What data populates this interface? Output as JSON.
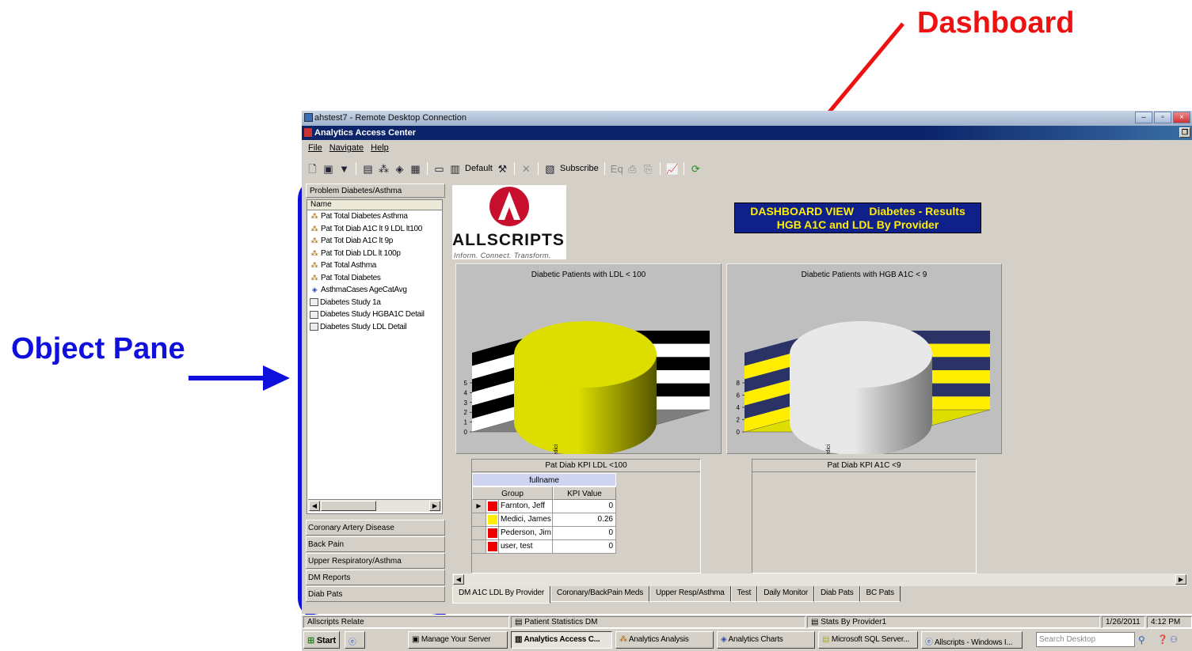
{
  "annotations": {
    "dashboard_label": "Dashboard",
    "object_pane_label": "Object Pane",
    "dashboard_color": "#ee1111",
    "object_pane_color": "#1010dd"
  },
  "rdp": {
    "title": "ahstest7 - Remote Desktop Connection",
    "minimize": "–",
    "restore": "▫",
    "close": "×"
  },
  "app": {
    "title": "Analytics Access Center"
  },
  "menu": [
    "File",
    "Navigate",
    "Help"
  ],
  "toolbar": {
    "default_label": "Default",
    "subscribe_label": "Subscribe"
  },
  "object_pane": {
    "header": "Problem Diabetes/Asthma",
    "column": "Name",
    "items": [
      {
        "icon": "kpi",
        "label": "Pat Total Diabetes Asthma"
      },
      {
        "icon": "kpi",
        "label": "Pat Tot Diab A1C lt 9 LDL lt100"
      },
      {
        "icon": "kpi",
        "label": "Pat Tot Diab A1C  lt 9p"
      },
      {
        "icon": "kpi",
        "label": "Pat Tot Diab LDL lt 100p"
      },
      {
        "icon": "kpi",
        "label": "Pat Total Asthma"
      },
      {
        "icon": "kpi",
        "label": "Pat Total Diabetes"
      },
      {
        "icon": "chart",
        "label": "AsthmaCases AgeCatAvg"
      },
      {
        "icon": "report",
        "label": "Diabetes Study 1a"
      },
      {
        "icon": "report",
        "label": "Diabetes Study HGBA1C Detail"
      },
      {
        "icon": "report",
        "label": "Diabetes Study LDL Detail"
      }
    ],
    "groups": [
      "Coronary Artery Disease",
      "Back Pain",
      "Upper Respiratory/Asthma",
      "DM Reports",
      "Diab Pats"
    ]
  },
  "dashboard": {
    "logo_text": "ALLSCRIPTS",
    "logo_tagline": "Inform. Connect. Transform.",
    "title_line1": "DASHBOARD VIEW     Diabetes - Results",
    "title_line2": "HGB A1C and LDL By Provider",
    "kpi_ldl_title": "Pat Diab KPI LDL <100",
    "kpi_a1c_title": "Pat Diab KPI A1C <9",
    "kpi_table": {
      "fullname_header": "fullname",
      "col_group": "Group",
      "col_value": "KPI Value",
      "rows": [
        {
          "indicator": "▶",
          "color": "#ee0000",
          "name": "Farnton, Jeff",
          "value": "0"
        },
        {
          "indicator": "",
          "color": "#ffee00",
          "name": "Medici, James",
          "value": "0.26"
        },
        {
          "indicator": "",
          "color": "#ee0000",
          "name": "Pederson, Jim",
          "value": "0"
        },
        {
          "indicator": "",
          "color": "#ee0000",
          "name": "user, test",
          "value": "0"
        }
      ]
    }
  },
  "chart_data": [
    {
      "type": "bar",
      "title": "Diabetic Patients with LDL < 100",
      "categories": [
        "Medici"
      ],
      "values": [
        5
      ],
      "ylim": [
        0,
        5
      ],
      "yticks": [
        "0",
        "1",
        "2",
        "3",
        "4",
        "5"
      ],
      "xlabel": "",
      "ylabel": "",
      "grid": true,
      "bar_color": "#dddd00",
      "wall_stripes": [
        "#000000",
        "#ffffff"
      ]
    },
    {
      "type": "bar",
      "title": "Diabetic Patients with HGB A1C < 9",
      "categories": [
        "Medici"
      ],
      "values": [
        8
      ],
      "ylim": [
        0,
        8
      ],
      "yticks": [
        "0",
        "2",
        "4",
        "6",
        "8"
      ],
      "xlabel": "",
      "ylabel": "",
      "grid": true,
      "bar_color": "#e8e8e8",
      "wall_stripes": [
        "#2a3266",
        "#ffee00"
      ]
    }
  ],
  "tabs": [
    "DM A1C LDL By Provider",
    "Coronary/BackPain Meds",
    "Upper Resp/Asthma",
    "Test",
    "Daily Monitor",
    "Diab Pats",
    "BC Pats"
  ],
  "statusbar": {
    "cell1": "Allscripts Relate",
    "cell2": "Patient Statistics DM",
    "cell3": "Stats By Provider1",
    "date": "1/26/2011",
    "time": "4:12 PM"
  },
  "taskbar": {
    "start": "Start",
    "items": [
      "Manage Your Server",
      "Analytics Access C...",
      "Analytics Analysis",
      "Analytics Charts",
      "Microsoft SQL Server...",
      "Allscripts - Windows I..."
    ],
    "search_placeholder": "Search Desktop"
  }
}
